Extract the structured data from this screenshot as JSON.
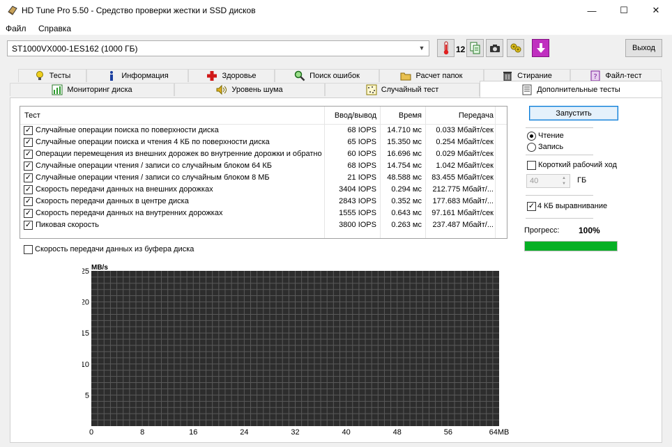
{
  "window": {
    "title": "HD Tune Pro 5.50 - Средство проверки жестки и SSD дисков",
    "minimize": "—",
    "maximize": "☐",
    "close": "✕"
  },
  "menu": {
    "file": "Файл",
    "help": "Справка"
  },
  "toolbar": {
    "disk": "ST1000VX000-1ES162 (1000 ГБ)",
    "temp_value": "12",
    "exit_label": "Выход",
    "icons": [
      "thermometer-icon",
      "copy-icon",
      "camera-icon",
      "gear-icon",
      "download-icon"
    ]
  },
  "tabs": {
    "row1": [
      "Тесты",
      "Информация",
      "Здоровье",
      "Поиск ошибок",
      "Расчет папок",
      "Стирание",
      "Файл-тест"
    ],
    "row2": [
      "Мониторинг диска",
      "Уровень шума",
      "Случайный тест",
      "Дополнительные тесты"
    ],
    "active": "Дополнительные тесты"
  },
  "grid": {
    "headers": [
      "Тест",
      "Ввод/вывод",
      "Время",
      "Передача"
    ],
    "rows": [
      {
        "checked": true,
        "test": "Случайные операции поиска по поверхности диска",
        "io": "68 IOPS",
        "time": "14.710 мс",
        "transfer": "0.033 Мбайт/сек"
      },
      {
        "checked": true,
        "test": "Случайные операции поиска и чтения 4 КБ по поверхности диска",
        "io": "65 IOPS",
        "time": "15.350 мс",
        "transfer": "0.254 Мбайт/сек"
      },
      {
        "checked": true,
        "test": "Операции перемещения из внешних дорожек во внутренние дорожки и обратно",
        "io": "60 IOPS",
        "time": "16.696 мс",
        "transfer": "0.029 Мбайт/сек"
      },
      {
        "checked": true,
        "test": "Случайные операции чтения / записи со случайным блоком 64 КБ",
        "io": "68 IOPS",
        "time": "14.754 мс",
        "transfer": "1.042 Мбайт/сек"
      },
      {
        "checked": true,
        "test": "Случайные операции чтения / записи со случайным блоком 8 МБ",
        "io": "21 IOPS",
        "time": "48.588 мс",
        "transfer": "83.455 Мбайт/сек"
      },
      {
        "checked": true,
        "test": "Скорость передачи данных на внешних дорожках",
        "io": "3404 IOPS",
        "time": "0.294 мс",
        "transfer": "212.775 Мбайт/..."
      },
      {
        "checked": true,
        "test": "Скорость передачи данных в центре диска",
        "io": "2843 IOPS",
        "time": "0.352 мс",
        "transfer": "177.683 Мбайт/..."
      },
      {
        "checked": true,
        "test": "Скорость передачи данных на внутренних дорожках",
        "io": "1555 IOPS",
        "time": "0.643 мс",
        "transfer": "97.161 Мбайт/сек"
      },
      {
        "checked": true,
        "test": "Пиковая скорость",
        "io": "3800 IOPS",
        "time": "0.263 мс",
        "transfer": "237.487 Мбайт/..."
      }
    ]
  },
  "buffer_checkbox": {
    "checked": false,
    "label": "Скорость передачи данных из буфера диска"
  },
  "side": {
    "start_label": "Запустить",
    "read_label": "Чтение",
    "write_label": "Запись",
    "mode": "read",
    "short_stroke_label": "Короткий рабочий ход",
    "short_stroke_checked": false,
    "short_stroke_value": "40",
    "short_stroke_unit": "ГБ",
    "align_label": "4 КБ выравнивание",
    "align_checked": true,
    "progress_label": "Прогресс:",
    "progress_value": "100%",
    "progress_fraction": 1.0,
    "progress_color": "#06b025"
  },
  "chart_data": {
    "type": "line",
    "ylabel": "MB/s",
    "ylim": [
      0,
      25
    ],
    "yticks": [
      "25",
      "20",
      "15",
      "10",
      "5"
    ],
    "xlim": [
      0,
      64
    ],
    "xticks": [
      "0",
      "8",
      "16",
      "24",
      "32",
      "40",
      "48",
      "56",
      "64MB"
    ],
    "series": [],
    "grid": true,
    "background": "#2d2d2d",
    "grid_color": "#5a5a5a"
  }
}
